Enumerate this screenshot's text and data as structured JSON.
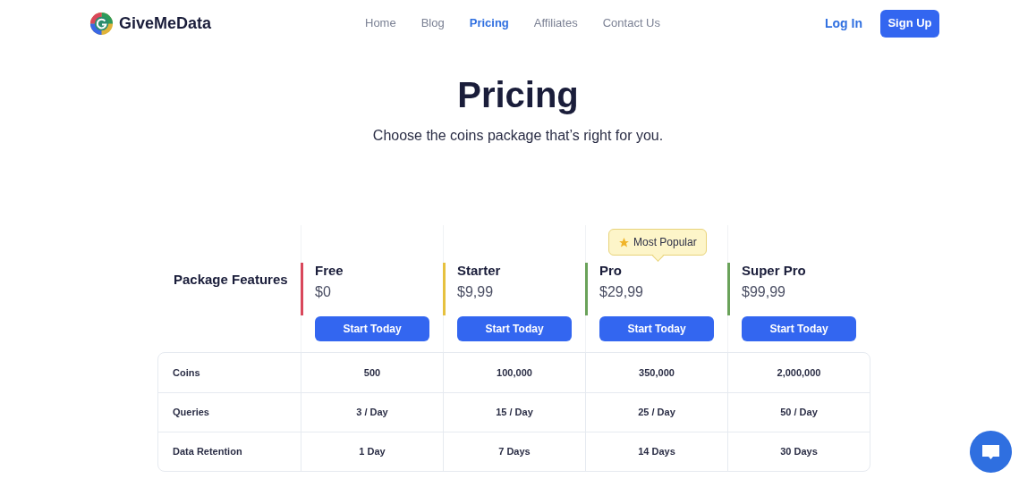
{
  "brand": {
    "name": "GiveMeData"
  },
  "nav": [
    {
      "label": "Home",
      "selected": false
    },
    {
      "label": "Blog",
      "selected": false
    },
    {
      "label": "Pricing",
      "selected": true
    },
    {
      "label": "Affiliates",
      "selected": false
    },
    {
      "label": "Contact Us",
      "selected": false
    }
  ],
  "auth": {
    "login": "Log In",
    "signup": "Sign Up"
  },
  "heading": "Pricing",
  "subtitle": "Choose the coins package that’s right for you.",
  "table": {
    "corner": "Package Features",
    "plans": [
      {
        "name": "Free",
        "price": "$0",
        "button": "Start Today",
        "color": "#d9475b"
      },
      {
        "name": "Starter",
        "price": "$9,99",
        "button": "Start Today",
        "color": "#e6c13f"
      },
      {
        "name": "Pro",
        "price": "$29,99",
        "button": "Start Today",
        "color": "#6aa25a",
        "badge": "Most Popular"
      },
      {
        "name": "Super Pro",
        "price": "$99,99",
        "button": "Start Today",
        "color": "#6aa25a"
      }
    ],
    "rows": [
      {
        "feature": "Coins",
        "values": [
          "500",
          "100,000",
          "350,000",
          "2,000,000"
        ]
      },
      {
        "feature": "Queries",
        "values": [
          "3 / Day",
          "15 / Day",
          "25 / Day",
          "50 / Day"
        ]
      },
      {
        "feature": "Data Retention",
        "values": [
          "1 Day",
          "7 Days",
          "14 Days",
          "30 Days"
        ]
      }
    ]
  }
}
